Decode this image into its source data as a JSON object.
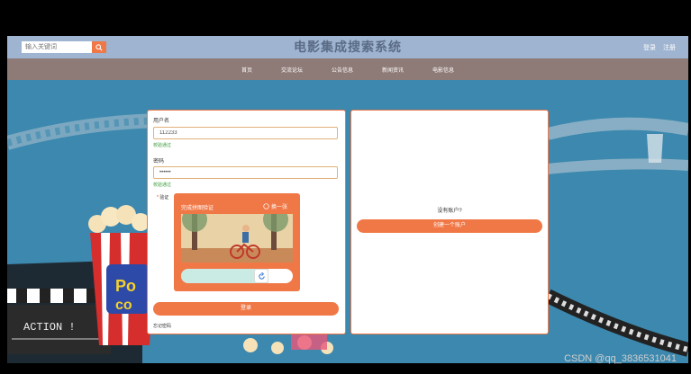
{
  "header": {
    "search_placeholder": "输入关键词",
    "title": "电影集成搜索系统",
    "login_label": "登录",
    "register_label": "注册"
  },
  "nav": {
    "items": [
      "首页",
      "交流论坛",
      "公告信息",
      "新闻资讯",
      "电影信息"
    ]
  },
  "login_form": {
    "username_label": "用户名",
    "username_value": "112233",
    "username_status": "校验通过",
    "password_label": "密码",
    "password_value": "••••••",
    "password_status": "校验通过",
    "captcha_required_mark": "*",
    "captcha_label": "验证",
    "login_button": "登录",
    "forgot_link": "忘记密码"
  },
  "captcha": {
    "title": "完成拼图验证",
    "refresh_label": "换一张",
    "slider_progress": 0.75
  },
  "register_panel": {
    "no_account_text": "没有账户?",
    "create_button": "创建一个账户"
  },
  "background": {
    "clapper_text": "ACTION !"
  },
  "watermark": "CSDN @qq_3836531041",
  "colors": {
    "accent": "#f07846",
    "header_bg": "#9fb4d1",
    "nav_bg": "#8e7a76",
    "page_bg": "#3c88ae",
    "success": "#3b9c3b"
  }
}
